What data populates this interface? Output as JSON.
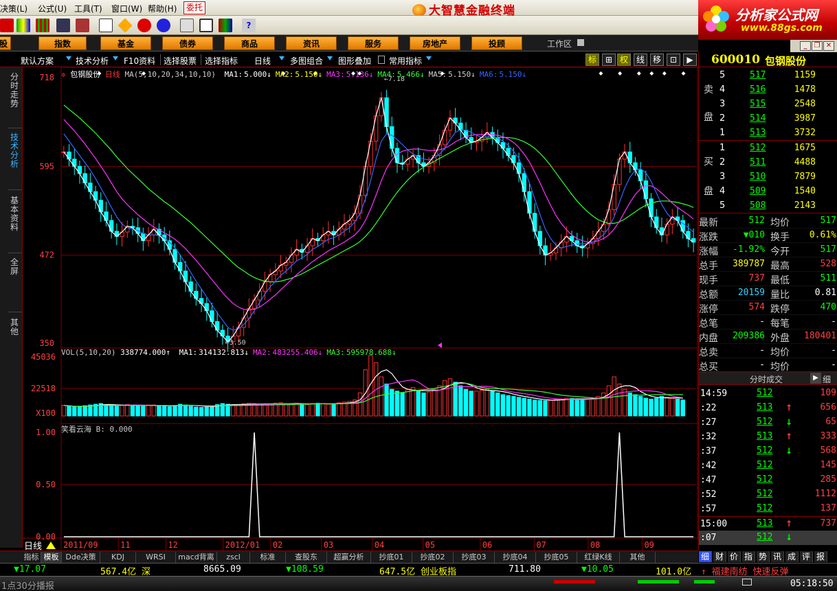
{
  "menu": {
    "items": [
      "决策(L)",
      "公式(U)",
      "工具(T)",
      "窗口(W)",
      "帮助(H)"
    ],
    "entrust": "委托"
  },
  "app_title": "大智慧金融终端",
  "brand": {
    "name": "分析家公式网",
    "url": "www.88gs.com"
  },
  "categories": [
    "股",
    "指数",
    "基金",
    "债券",
    "商品",
    "资讯",
    "服务",
    "房地产",
    "投顾"
  ],
  "workspace": "工作区",
  "subbar": {
    "items": [
      "默认方案",
      "技术分析",
      "F10资料",
      "选择股票",
      "选择指标",
      "日线",
      "多图组合",
      "图形叠加",
      "常用指标"
    ],
    "modes": [
      "标",
      "⊞",
      "权",
      "线",
      "移",
      "⊡",
      "▶"
    ]
  },
  "left_tabs": [
    "分时走势",
    "技术分析",
    "基本资料",
    "全屏",
    "其他"
  ],
  "chart_header": {
    "title": "包钢股份",
    "period": "日线",
    "ma_params": "MA(5,10,20,34,10,10)",
    "ma_values": [
      {
        "label": "MA1:",
        "value": "5.000↓",
        "color": "#ffffff"
      },
      {
        "label": "MA2:",
        "value": "5.150↓",
        "color": "#ffff00"
      },
      {
        "label": "MA3:",
        "value": "5.136↓",
        "color": "#ff33ff"
      },
      {
        "label": "MA4:",
        "value": "5.466↓",
        "color": "#33ff33"
      },
      {
        "label": "MA5:",
        "value": "5.150↓",
        "color": "#cccccc"
      },
      {
        "label": "MA6:",
        "value": "5.150↓",
        "color": "#3366ff"
      }
    ],
    "high_mark": "7.18",
    "low_mark": "3.50",
    "price_axis": [
      "718",
      "595",
      "472",
      "350"
    ]
  },
  "vol_header": {
    "params": "VOL(5,10,20)",
    "value": "338774.000↑",
    "ma_values": [
      {
        "label": "MA1:",
        "value": "314132.813↓",
        "color": "#ffffff"
      },
      {
        "label": "MA2:",
        "value": "483255.406↓",
        "color": "#ff33ff"
      },
      {
        "label": "MA3:",
        "value": "595978.688↓",
        "color": "#33ff33"
      }
    ],
    "axis": [
      "45036",
      "22518",
      "X100"
    ]
  },
  "ind_header": {
    "name": "笑看云海",
    "value": "B: 0.000",
    "axis": [
      "1.00",
      "0.50",
      "0.00"
    ]
  },
  "date_axis": {
    "label": "日线",
    "ticks": [
      "2011/09",
      "11",
      "12",
      "2012/01",
      "02",
      "03",
      "04",
      "05",
      "06",
      "07",
      "08",
      "09"
    ]
  },
  "chart_data": {
    "type": "line",
    "ylim": [
      3.5,
      7.18
    ],
    "close": [
      6.15,
      6.05,
      5.95,
      5.85,
      5.72,
      5.6,
      5.48,
      5.32,
      5.2,
      5.05,
      4.98,
      5.04,
      5.12,
      5.1,
      5.02,
      4.92,
      5.0,
      5.08,
      5.0,
      4.92,
      4.8,
      4.62,
      4.5,
      4.35,
      4.22,
      4.12,
      4.05,
      3.95,
      3.8,
      3.68,
      3.6,
      3.52,
      3.6,
      3.72,
      3.85,
      3.98,
      4.1,
      4.22,
      4.35,
      4.45,
      4.5,
      4.58,
      4.62,
      4.72,
      4.8,
      4.76,
      4.85,
      4.95,
      4.92,
      5.0,
      5.05,
      5.0,
      5.08,
      5.15,
      5.2,
      5.3,
      5.55,
      5.95,
      6.3,
      6.65,
      6.9,
      6.5,
      6.2,
      6.0,
      5.98,
      6.05,
      6.1,
      6.0,
      5.95,
      6.0,
      6.1,
      6.25,
      6.45,
      6.62,
      6.55,
      6.45,
      6.35,
      6.28,
      6.3,
      6.35,
      6.42,
      6.35,
      6.28,
      6.2,
      6.1,
      6.0,
      5.85,
      5.6,
      5.3,
      5.05,
      4.85,
      4.72,
      4.75,
      4.82,
      4.9,
      4.98,
      4.92,
      4.85,
      4.82,
      4.88,
      4.95,
      5.05,
      5.15,
      5.35,
      5.7,
      6.05,
      6.15,
      6.0,
      5.9,
      5.75,
      5.5,
      5.25,
      5.1,
      5.0,
      5.15,
      5.25,
      5.2,
      5.05,
      4.95,
      4.9
    ],
    "ma_fast": [
      6.4,
      6.3,
      6.2,
      6.1,
      6.0,
      5.9,
      5.78,
      5.65,
      5.52,
      5.38,
      5.25,
      5.15,
      5.1,
      5.08,
      5.06,
      5.02,
      5.0,
      5.0,
      4.99,
      4.96,
      4.9,
      4.82,
      4.72,
      4.6,
      4.48,
      4.36,
      4.25,
      4.14,
      4.03,
      3.92,
      3.82,
      3.72,
      3.68,
      3.7,
      3.76,
      3.84,
      3.95,
      4.06,
      4.18,
      4.28,
      4.36,
      4.44,
      4.5,
      4.57,
      4.64,
      4.68,
      4.73,
      4.8,
      4.84,
      4.89,
      4.94,
      4.96,
      5.0,
      5.05,
      5.1,
      5.18,
      5.3,
      5.5,
      5.75,
      6.05,
      6.3,
      6.4,
      6.38,
      6.32,
      6.25,
      6.18,
      6.12,
      6.08,
      6.05,
      6.04,
      6.07,
      6.12,
      6.2,
      6.32,
      6.42,
      6.46,
      6.45,
      6.42,
      6.38,
      6.35,
      6.36,
      6.36,
      6.34,
      6.3,
      6.24,
      6.16,
      6.06,
      5.9,
      5.72,
      5.5,
      5.28,
      5.08,
      4.95,
      4.86,
      4.82,
      4.84,
      4.86,
      4.87,
      4.88,
      4.88,
      4.9,
      4.95,
      5.0,
      5.1,
      5.25,
      5.45,
      5.65,
      5.8,
      5.9,
      5.92,
      5.86,
      5.74,
      5.58,
      5.42,
      5.3,
      5.22,
      5.2,
      5.16,
      5.1,
      5.04
    ],
    "ma_mid": [
      6.6,
      6.52,
      6.44,
      6.35,
      6.26,
      6.16,
      6.06,
      5.95,
      5.84,
      5.72,
      5.6,
      5.5,
      5.42,
      5.35,
      5.28,
      5.22,
      5.16,
      5.11,
      5.07,
      5.03,
      4.99,
      4.94,
      4.88,
      4.81,
      4.73,
      4.65,
      4.56,
      4.47,
      4.38,
      4.29,
      4.2,
      4.12,
      4.05,
      4.0,
      3.97,
      3.96,
      3.97,
      4.0,
      4.05,
      4.11,
      4.17,
      4.24,
      4.31,
      4.38,
      4.45,
      4.51,
      4.57,
      4.63,
      4.68,
      4.73,
      4.78,
      4.82,
      4.86,
      4.9,
      4.95,
      5.0,
      5.08,
      5.2,
      5.36,
      5.55,
      5.75,
      5.92,
      6.04,
      6.12,
      6.16,
      6.18,
      6.19,
      6.19,
      6.18,
      6.17,
      6.17,
      6.18,
      6.2,
      6.24,
      6.29,
      6.33,
      6.36,
      6.38,
      6.39,
      6.39,
      6.39,
      6.39,
      6.38,
      6.36,
      6.33,
      6.28,
      6.21,
      6.12,
      6.01,
      5.87,
      5.72,
      5.56,
      5.41,
      5.27,
      5.16,
      5.07,
      5.0,
      4.95,
      4.92,
      4.9,
      4.9,
      4.92,
      4.95,
      5.0,
      5.08,
      5.19,
      5.32,
      5.45,
      5.56,
      5.64,
      5.68,
      5.68,
      5.64,
      5.58,
      5.51,
      5.44,
      5.38,
      5.33,
      5.28,
      5.22
    ],
    "ma_slow": [
      6.8,
      6.74,
      6.68,
      6.62,
      6.55,
      6.48,
      6.41,
      6.33,
      6.25,
      6.17,
      6.08,
      6.0,
      5.92,
      5.85,
      5.78,
      5.71,
      5.64,
      5.58,
      5.52,
      5.46,
      5.41,
      5.35,
      5.29,
      5.23,
      5.17,
      5.1,
      5.03,
      4.96,
      4.89,
      4.82,
      4.75,
      4.68,
      4.61,
      4.55,
      4.5,
      4.45,
      4.41,
      4.38,
      4.36,
      4.35,
      4.35,
      4.36,
      4.38,
      4.4,
      4.43,
      4.46,
      4.5,
      4.54,
      4.58,
      4.62,
      4.66,
      4.7,
      4.74,
      4.78,
      4.82,
      4.86,
      4.91,
      4.98,
      5.06,
      5.16,
      5.27,
      5.38,
      5.49,
      5.59,
      5.68,
      5.76,
      5.83,
      5.89,
      5.94,
      5.98,
      6.02,
      6.06,
      6.1,
      6.14,
      6.18,
      6.22,
      6.25,
      6.28,
      6.3,
      6.32,
      6.33,
      6.34,
      6.35,
      6.35,
      6.35,
      6.34,
      6.32,
      6.29,
      6.25,
      6.2,
      6.13,
      6.05,
      5.96,
      5.86,
      5.76,
      5.66,
      5.56,
      5.47,
      5.39,
      5.32,
      5.26,
      5.21,
      5.18,
      5.16,
      5.16,
      5.18,
      5.22,
      5.27,
      5.32,
      5.37,
      5.41,
      5.44,
      5.46,
      5.47,
      5.47,
      5.46,
      5.45,
      5.43,
      5.41,
      5.38
    ],
    "volume": [
      60,
      55,
      50,
      52,
      58,
      62,
      66,
      70,
      64,
      58,
      55,
      60,
      64,
      62,
      58,
      55,
      60,
      62,
      58,
      55,
      52,
      58,
      66,
      62,
      55,
      50,
      48,
      52,
      58,
      64,
      70,
      66,
      60,
      62,
      68,
      72,
      70,
      66,
      64,
      68,
      72,
      74,
      70,
      68,
      72,
      66,
      64,
      70,
      72,
      68,
      66,
      70,
      74,
      78,
      82,
      90,
      130,
      260,
      340,
      300,
      220,
      180,
      150,
      140,
      130,
      150,
      160,
      140,
      130,
      135,
      150,
      170,
      200,
      210,
      190,
      170,
      150,
      140,
      140,
      145,
      150,
      140,
      130,
      120,
      115,
      110,
      105,
      100,
      95,
      90,
      88,
      86,
      88,
      92,
      96,
      100,
      98,
      95,
      92,
      96,
      100,
      110,
      130,
      170,
      220,
      180,
      150,
      130,
      120,
      110,
      100,
      95,
      100,
      110,
      105,
      100,
      95,
      90
    ],
    "indicator_spikes_at": [
      36,
      105
    ]
  },
  "right_panel": {
    "code": "600010",
    "name": "包钢股份",
    "sell_label": [
      "卖",
      "盘"
    ],
    "buy_label": [
      "买",
      "盘"
    ],
    "sell": [
      {
        "lv": "5",
        "price": "517",
        "vol": "1159"
      },
      {
        "lv": "4",
        "price": "516",
        "vol": "1478"
      },
      {
        "lv": "3",
        "price": "515",
        "vol": "2548"
      },
      {
        "lv": "2",
        "price": "514",
        "vol": "3987"
      },
      {
        "lv": "1",
        "price": "513",
        "vol": "3732"
      }
    ],
    "buy": [
      {
        "lv": "1",
        "price": "512",
        "vol": "1675"
      },
      {
        "lv": "2",
        "price": "511",
        "vol": "4488"
      },
      {
        "lv": "3",
        "price": "510",
        "vol": "7879"
      },
      {
        "lv": "4",
        "price": "509",
        "vol": "1540"
      },
      {
        "lv": "5",
        "price": "508",
        "vol": "2143"
      }
    ],
    "quotes": [
      {
        "l1": "最新",
        "v1": "512",
        "c1": "#00ff00",
        "l2": "均价",
        "v2": "517",
        "c2": "#00ff00"
      },
      {
        "l1": "涨跌",
        "v1": "▼010",
        "c1": "#00ff00",
        "l2": "换手",
        "v2": "0.61%",
        "c2": "#ffff00"
      },
      {
        "l1": "涨幅",
        "v1": "-1.92%",
        "c1": "#00ff00",
        "l2": "今开",
        "v2": "517",
        "c2": "#00ff00"
      },
      {
        "l1": "总手",
        "v1": "389787",
        "c1": "#ffff00",
        "l2": "最高",
        "v2": "528",
        "c2": "#ff4040"
      },
      {
        "l1": "现手",
        "v1": "737",
        "c1": "#ff4040",
        "l2": "最低",
        "v2": "511",
        "c2": "#00ff00"
      },
      {
        "l1": "总额",
        "v1": "20159",
        "c1": "#3bd0ff",
        "l2": "量比",
        "v2": "0.81",
        "c2": "#ffffff"
      },
      {
        "l1": "涨停",
        "v1": "574",
        "c1": "#ff4040",
        "l2": "跌停",
        "v2": "470",
        "c2": "#00ff00"
      },
      {
        "l1": "总笔",
        "v1": "-",
        "c1": "#ffffff",
        "l2": "每笔",
        "v2": "-",
        "c2": "#ffffff"
      },
      {
        "l1": "内盘",
        "v1": "209386",
        "c1": "#00ff00",
        "l2": "外盘",
        "v2": "180401",
        "c2": "#ff4040"
      },
      {
        "l1": "总卖",
        "v1": "-",
        "c1": "#ffffff",
        "l2": "均价",
        "v2": "-",
        "c2": "#ffffff"
      },
      {
        "l1": "总买",
        "v1": "-",
        "c1": "#ffffff",
        "l2": "均价",
        "v2": "-",
        "c2": "#ffffff"
      }
    ],
    "ticks_title": "分时成交",
    "ticks_detail": "细",
    "ticks": [
      {
        "time": "14:59",
        "price": "512",
        "arrow": "",
        "vol": "109",
        "pc": "#00ff00",
        "vc": "#ff4040"
      },
      {
        "time": ":22",
        "price": "513",
        "arrow": "↑",
        "vol": "656",
        "pc": "#00ff00",
        "vc": "#ff4040"
      },
      {
        "time": ":27",
        "price": "512",
        "arrow": "↓",
        "vol": "65",
        "pc": "#00ff00",
        "vc": "#ff4040"
      },
      {
        "time": ":32",
        "price": "513",
        "arrow": "↑",
        "vol": "333",
        "pc": "#00ff00",
        "vc": "#ff4040"
      },
      {
        "time": ":37",
        "price": "512",
        "arrow": "↓",
        "vol": "568",
        "pc": "#00ff00",
        "vc": "#ff4040"
      },
      {
        "time": ":42",
        "price": "512",
        "arrow": "",
        "vol": "145",
        "pc": "#00ff00",
        "vc": "#ff4040"
      },
      {
        "time": ":47",
        "price": "512",
        "arrow": "",
        "vol": "285",
        "pc": "#00ff00",
        "vc": "#ff4040"
      },
      {
        "time": ":52",
        "price": "512",
        "arrow": "",
        "vol": "1112",
        "pc": "#00ff00",
        "vc": "#ff4040"
      },
      {
        "time": ":57",
        "price": "512",
        "arrow": "",
        "vol": "137",
        "pc": "#00ff00",
        "vc": "#ff4040"
      },
      {
        "time": "15:00",
        "price": "513",
        "arrow": "↑",
        "vol": "737",
        "pc": "#00ff00",
        "vc": "#ff4040"
      },
      {
        "time": ":07",
        "price": "512",
        "arrow": "↓",
        "vol": "",
        "pc": "#00ff00",
        "vc": "#ff4040"
      }
    ],
    "bottom_tabs": [
      "细",
      "财",
      "价",
      "指",
      "势",
      "讯",
      "成",
      "评",
      "报"
    ]
  },
  "bottom_tabs": [
    "指标",
    "模板",
    "Dde决策",
    "KDJ",
    "WRSI",
    "macd背离",
    "zscl",
    "标准",
    "查股东",
    "超赢分析",
    "抄底01",
    "抄底02",
    "抄底03",
    "抄底04",
    "抄底05",
    "红绿K线",
    "其他"
  ],
  "ticker": [
    {
      "text": "▼17.07",
      "color": "#00ff00"
    },
    {
      "text": "567.4亿 深",
      "color": "#ffff00"
    },
    {
      "text": "8665.09",
      "color": "#ffffff"
    },
    {
      "text": "▼108.59",
      "color": "#00ff00"
    },
    {
      "text": "647.5亿 创业板指",
      "color": "#ffff00"
    },
    {
      "text": "711.80",
      "color": "#ffffff"
    },
    {
      "text": "▼10.05",
      "color": "#00ff00"
    },
    {
      "text": "101.0亿",
      "color": "#ffff00"
    },
    {
      "text": "↑ 福建南纺 快速反弹",
      "color": "#ff4040"
    }
  ],
  "status": {
    "broadcast": "1点30分播报",
    "clock": "05:18:50"
  },
  "colors": {
    "candle_up": "#ff3030",
    "candle_down": "#00ffff",
    "ma_fast": "#3366ff",
    "ma_mid": "#ff33ff",
    "ma_slow": "#33ff33",
    "close_line": "#ffffff",
    "grid": "#800000"
  }
}
